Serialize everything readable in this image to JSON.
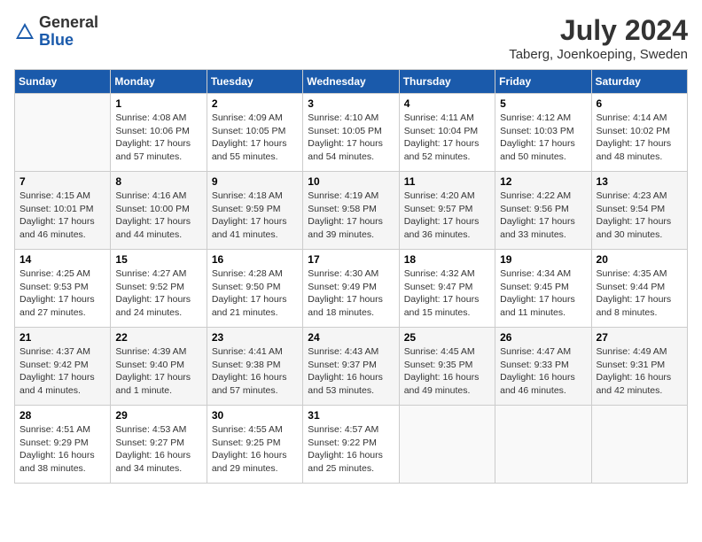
{
  "header": {
    "logo_general": "General",
    "logo_blue": "Blue",
    "month_title": "July 2024",
    "location": "Taberg, Joenkoeping, Sweden"
  },
  "days_of_week": [
    "Sunday",
    "Monday",
    "Tuesday",
    "Wednesday",
    "Thursday",
    "Friday",
    "Saturday"
  ],
  "weeks": [
    [
      {
        "day": "",
        "info": ""
      },
      {
        "day": "1",
        "info": "Sunrise: 4:08 AM\nSunset: 10:06 PM\nDaylight: 17 hours\nand 57 minutes."
      },
      {
        "day": "2",
        "info": "Sunrise: 4:09 AM\nSunset: 10:05 PM\nDaylight: 17 hours\nand 55 minutes."
      },
      {
        "day": "3",
        "info": "Sunrise: 4:10 AM\nSunset: 10:05 PM\nDaylight: 17 hours\nand 54 minutes."
      },
      {
        "day": "4",
        "info": "Sunrise: 4:11 AM\nSunset: 10:04 PM\nDaylight: 17 hours\nand 52 minutes."
      },
      {
        "day": "5",
        "info": "Sunrise: 4:12 AM\nSunset: 10:03 PM\nDaylight: 17 hours\nand 50 minutes."
      },
      {
        "day": "6",
        "info": "Sunrise: 4:14 AM\nSunset: 10:02 PM\nDaylight: 17 hours\nand 48 minutes."
      }
    ],
    [
      {
        "day": "7",
        "info": "Sunrise: 4:15 AM\nSunset: 10:01 PM\nDaylight: 17 hours\nand 46 minutes."
      },
      {
        "day": "8",
        "info": "Sunrise: 4:16 AM\nSunset: 10:00 PM\nDaylight: 17 hours\nand 44 minutes."
      },
      {
        "day": "9",
        "info": "Sunrise: 4:18 AM\nSunset: 9:59 PM\nDaylight: 17 hours\nand 41 minutes."
      },
      {
        "day": "10",
        "info": "Sunrise: 4:19 AM\nSunset: 9:58 PM\nDaylight: 17 hours\nand 39 minutes."
      },
      {
        "day": "11",
        "info": "Sunrise: 4:20 AM\nSunset: 9:57 PM\nDaylight: 17 hours\nand 36 minutes."
      },
      {
        "day": "12",
        "info": "Sunrise: 4:22 AM\nSunset: 9:56 PM\nDaylight: 17 hours\nand 33 minutes."
      },
      {
        "day": "13",
        "info": "Sunrise: 4:23 AM\nSunset: 9:54 PM\nDaylight: 17 hours\nand 30 minutes."
      }
    ],
    [
      {
        "day": "14",
        "info": "Sunrise: 4:25 AM\nSunset: 9:53 PM\nDaylight: 17 hours\nand 27 minutes."
      },
      {
        "day": "15",
        "info": "Sunrise: 4:27 AM\nSunset: 9:52 PM\nDaylight: 17 hours\nand 24 minutes."
      },
      {
        "day": "16",
        "info": "Sunrise: 4:28 AM\nSunset: 9:50 PM\nDaylight: 17 hours\nand 21 minutes."
      },
      {
        "day": "17",
        "info": "Sunrise: 4:30 AM\nSunset: 9:49 PM\nDaylight: 17 hours\nand 18 minutes."
      },
      {
        "day": "18",
        "info": "Sunrise: 4:32 AM\nSunset: 9:47 PM\nDaylight: 17 hours\nand 15 minutes."
      },
      {
        "day": "19",
        "info": "Sunrise: 4:34 AM\nSunset: 9:45 PM\nDaylight: 17 hours\nand 11 minutes."
      },
      {
        "day": "20",
        "info": "Sunrise: 4:35 AM\nSunset: 9:44 PM\nDaylight: 17 hours\nand 8 minutes."
      }
    ],
    [
      {
        "day": "21",
        "info": "Sunrise: 4:37 AM\nSunset: 9:42 PM\nDaylight: 17 hours\nand 4 minutes."
      },
      {
        "day": "22",
        "info": "Sunrise: 4:39 AM\nSunset: 9:40 PM\nDaylight: 17 hours\nand 1 minute."
      },
      {
        "day": "23",
        "info": "Sunrise: 4:41 AM\nSunset: 9:38 PM\nDaylight: 16 hours\nand 57 minutes."
      },
      {
        "day": "24",
        "info": "Sunrise: 4:43 AM\nSunset: 9:37 PM\nDaylight: 16 hours\nand 53 minutes."
      },
      {
        "day": "25",
        "info": "Sunrise: 4:45 AM\nSunset: 9:35 PM\nDaylight: 16 hours\nand 49 minutes."
      },
      {
        "day": "26",
        "info": "Sunrise: 4:47 AM\nSunset: 9:33 PM\nDaylight: 16 hours\nand 46 minutes."
      },
      {
        "day": "27",
        "info": "Sunrise: 4:49 AM\nSunset: 9:31 PM\nDaylight: 16 hours\nand 42 minutes."
      }
    ],
    [
      {
        "day": "28",
        "info": "Sunrise: 4:51 AM\nSunset: 9:29 PM\nDaylight: 16 hours\nand 38 minutes."
      },
      {
        "day": "29",
        "info": "Sunrise: 4:53 AM\nSunset: 9:27 PM\nDaylight: 16 hours\nand 34 minutes."
      },
      {
        "day": "30",
        "info": "Sunrise: 4:55 AM\nSunset: 9:25 PM\nDaylight: 16 hours\nand 29 minutes."
      },
      {
        "day": "31",
        "info": "Sunrise: 4:57 AM\nSunset: 9:22 PM\nDaylight: 16 hours\nand 25 minutes."
      },
      {
        "day": "",
        "info": ""
      },
      {
        "day": "",
        "info": ""
      },
      {
        "day": "",
        "info": ""
      }
    ]
  ]
}
